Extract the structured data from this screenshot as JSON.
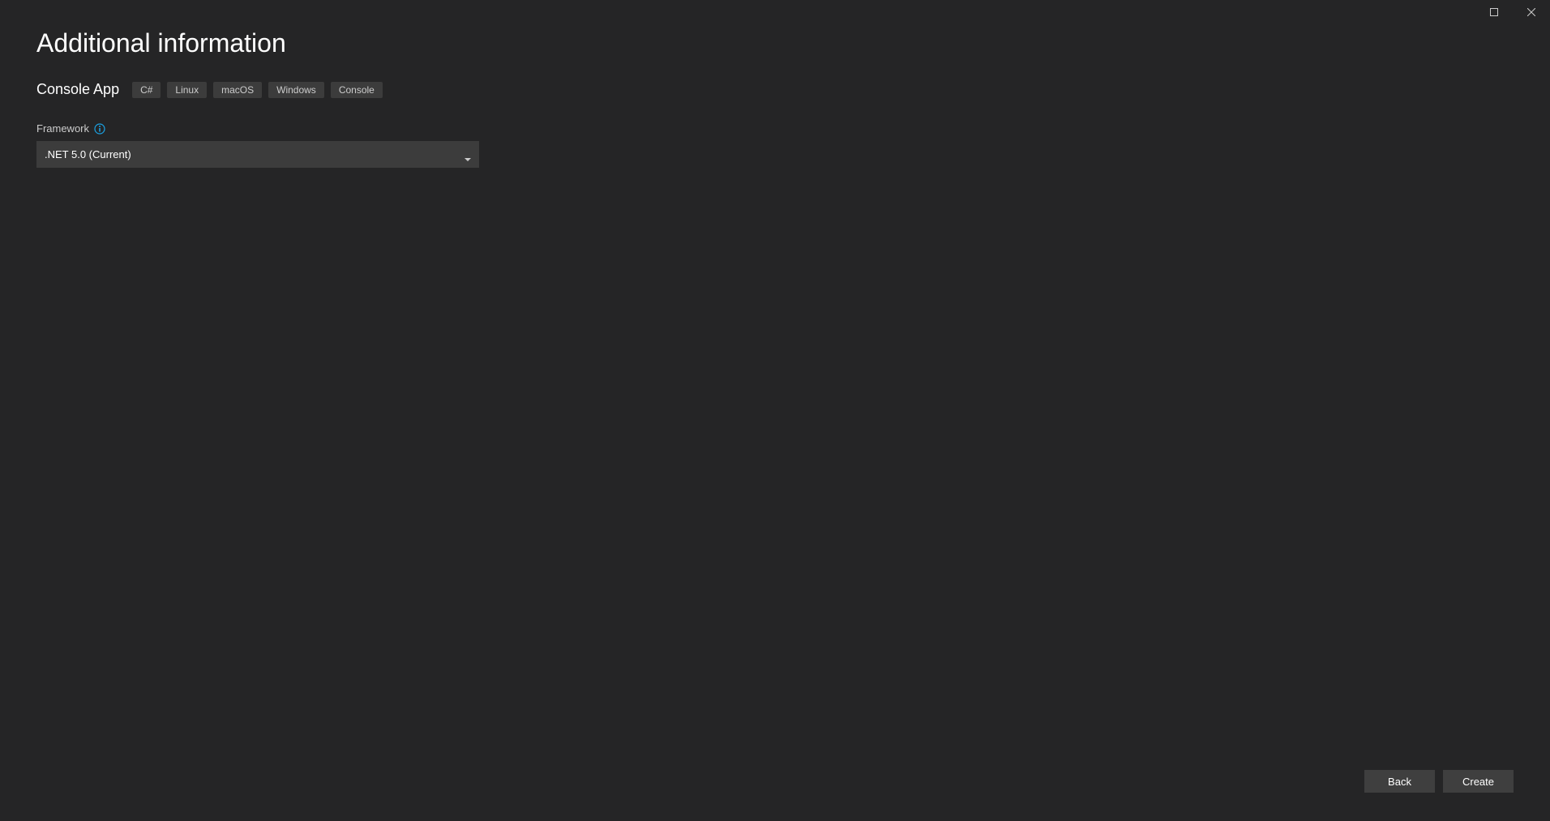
{
  "page": {
    "title": "Additional information",
    "subtitle": "Console App",
    "tags": [
      "C#",
      "Linux",
      "macOS",
      "Windows",
      "Console"
    ]
  },
  "framework": {
    "label": "Framework",
    "selected": ".NET 5.0 (Current)"
  },
  "buttons": {
    "back": "Back",
    "create": "Create"
  }
}
